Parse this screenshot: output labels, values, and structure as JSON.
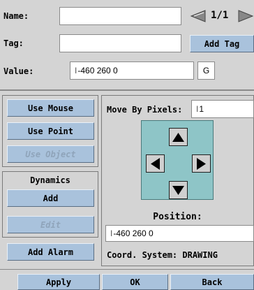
{
  "form": {
    "name_label": "Name:",
    "name_value": "",
    "page_indicator": "1/1",
    "tag_label": "Tag:",
    "tag_value": "",
    "add_tag_label": "Add Tag",
    "value_label": "Value:",
    "value_value": "-460 260 0",
    "value_flag": "G"
  },
  "left_panel": {
    "use_mouse": "Use Mouse",
    "use_point": "Use Point",
    "use_object": "Use Object",
    "dynamics_heading": "Dynamics",
    "dyn_add": "Add",
    "dyn_edit": "Edit",
    "add_alarm": "Add Alarm"
  },
  "move_panel": {
    "move_label": "Move By Pixels:",
    "move_value": "1",
    "position_label": "Position:",
    "position_value": "-460 260 0",
    "coord_label": "Coord. System: DRAWING"
  },
  "footer": {
    "apply": "Apply",
    "ok": "OK",
    "back": "Back"
  },
  "colors": {
    "button_blue": "#a9c2dc",
    "dpad_background": "#8ec5c7",
    "window_gray": "#d4d4d4"
  }
}
